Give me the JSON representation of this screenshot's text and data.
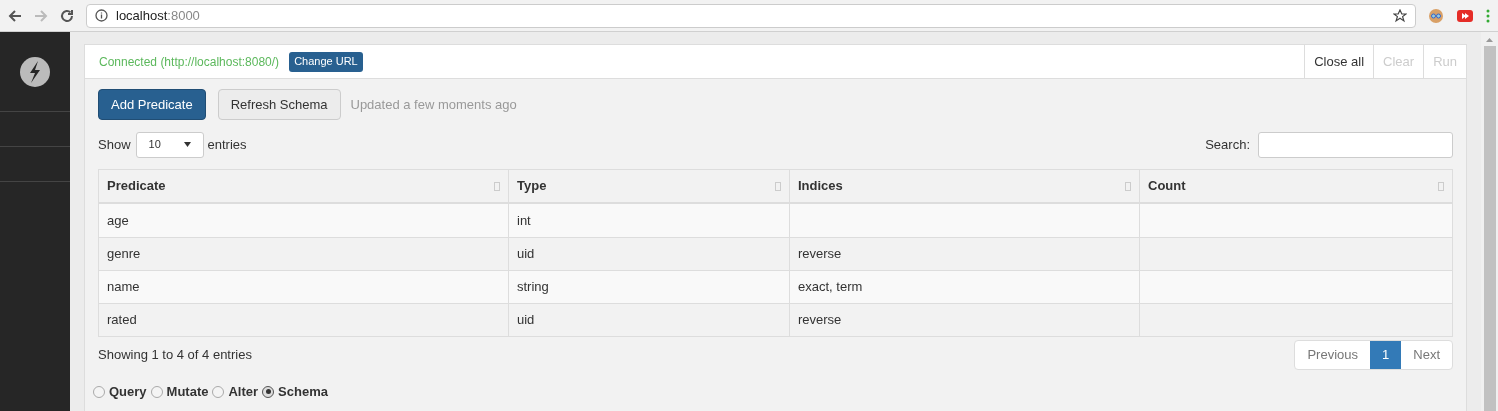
{
  "browser": {
    "url_host": "localhost",
    "url_port": ":8000"
  },
  "connection": {
    "status": "Connected (http://localhost:8080/)",
    "change_button": "Change URL"
  },
  "toolbar_buttons": [
    {
      "label": "Close all",
      "disabled": false
    },
    {
      "label": "Clear",
      "disabled": true
    },
    {
      "label": "Run",
      "disabled": true
    }
  ],
  "actions": {
    "primary": "Add Predicate",
    "secondary": "Refresh Schema",
    "updated": "Updated a few moments ago"
  },
  "length": {
    "show": "Show",
    "value": "10",
    "entries": "entries"
  },
  "search": {
    "label": "Search:"
  },
  "table": {
    "columns": [
      "Predicate",
      "Type",
      "Indices",
      "Count"
    ],
    "rows": [
      [
        "age",
        "int",
        "",
        ""
      ],
      [
        "genre",
        "uid",
        "reverse",
        ""
      ],
      [
        "name",
        "string",
        "exact, term",
        ""
      ],
      [
        "rated",
        "uid",
        "reverse",
        ""
      ]
    ]
  },
  "info": "Showing 1 to 4 of 4 entries",
  "pagination": [
    {
      "label": "Previous",
      "selected": false
    },
    {
      "label": "1",
      "selected": true
    },
    {
      "label": "Next",
      "selected": false
    }
  ],
  "modes": [
    {
      "label": "Query",
      "selected": false
    },
    {
      "label": "Mutate",
      "selected": false
    },
    {
      "label": "Alter",
      "selected": false
    },
    {
      "label": "Schema",
      "selected": true
    }
  ]
}
